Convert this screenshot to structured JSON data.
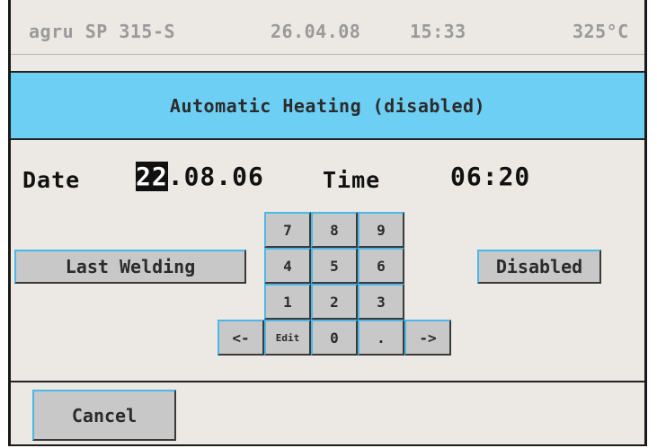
{
  "header": {
    "device": "agru SP 315-S",
    "date": "26.04.08",
    "time": "15:33",
    "temperature": "325°C"
  },
  "title": "Automatic Heating (disabled)",
  "datetime": {
    "date_label": "Date",
    "date_cursor": "22",
    "date_rest": ".08.06",
    "time_label": "Time",
    "time_value": "06:20"
  },
  "buttons": {
    "last_welding": "Last Welding",
    "disabled": "Disabled",
    "cancel": "Cancel"
  },
  "keypad": {
    "k7": "7",
    "k8": "8",
    "k9": "9",
    "k4": "4",
    "k5": "5",
    "k6": "6",
    "k1": "1",
    "k2": "2",
    "k3": "3",
    "left": "<-",
    "edit": "Edit",
    "k0": "0",
    "dot": ".",
    "right": "->"
  },
  "colors": {
    "title_bg": "#6ecff4",
    "button_bg": "#c8c8c8",
    "panel_bg": "#ece8e4"
  }
}
